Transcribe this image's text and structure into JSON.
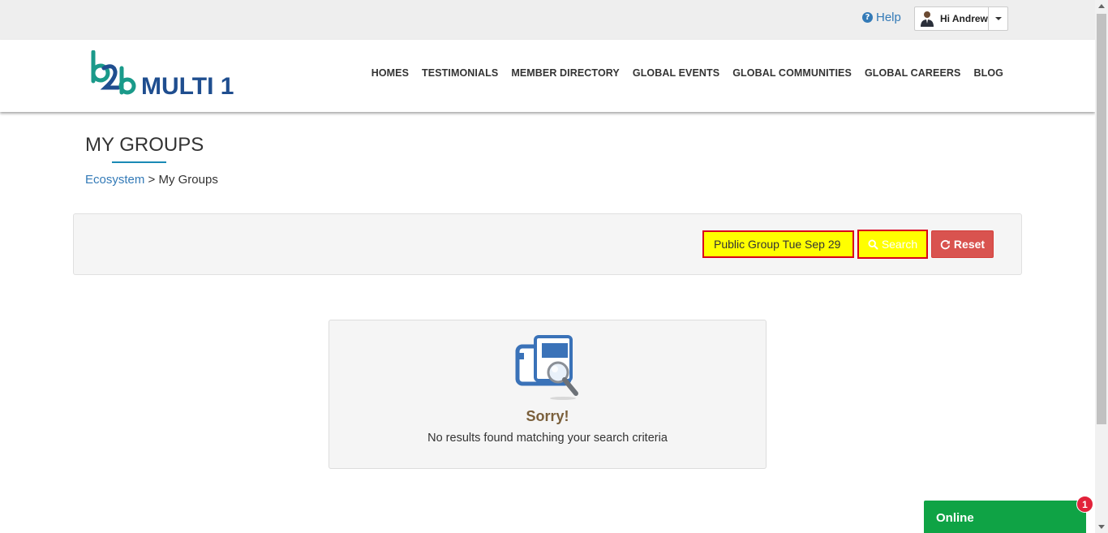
{
  "topbar": {
    "help_label": "Help",
    "user_greeting": "Hi Andrew"
  },
  "header": {
    "logo_text": "MULTI 1",
    "logo_mark": "b2b",
    "nav": [
      {
        "label": "HOMES"
      },
      {
        "label": "TESTIMONIALS"
      },
      {
        "label": "MEMBER DIRECTORY"
      },
      {
        "label": "GLOBAL EVENTS"
      },
      {
        "label": "GLOBAL COMMUNITIES"
      },
      {
        "label": "GLOBAL CAREERS"
      },
      {
        "label": "BLOG"
      }
    ]
  },
  "page": {
    "title": "MY GROUPS",
    "breadcrumb": {
      "link": "Ecosystem",
      "separator": ">",
      "current": "My Groups"
    }
  },
  "search": {
    "value": "Public Group Tue Sep 29 (",
    "search_label": "Search",
    "reset_label": "Reset"
  },
  "empty_state": {
    "heading": "Sorry!",
    "message": "No results found matching your search criteria"
  },
  "chat": {
    "label": "Online",
    "badge_count": "1"
  },
  "colors": {
    "accent_blue": "#337ab7",
    "highlight_yellow": "#ffff00",
    "highlight_border": "#d9001b",
    "reset_red": "#d9534f",
    "chat_green": "#0fa345",
    "logo_teal": "#1a9a8a",
    "logo_navy": "#1f4e8f"
  }
}
